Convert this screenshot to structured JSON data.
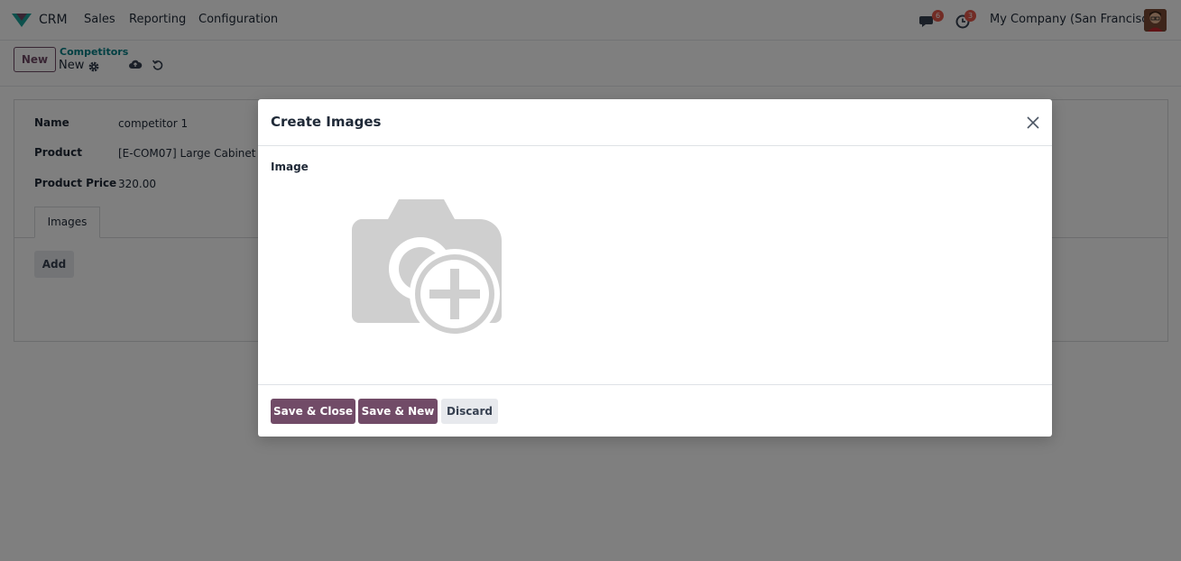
{
  "navbar": {
    "app_name": "CRM",
    "menu": [
      "Sales",
      "Reporting",
      "Configuration"
    ],
    "messages_count": "6",
    "activities_count": "3",
    "company": "My Company (San Francisco)",
    "icons": {
      "app": "crm-logo-icon",
      "messages": "chat-bubbles-icon",
      "activities": "clock-icon"
    }
  },
  "control_panel": {
    "new_label": "New",
    "breadcrumb_parent": "Competitors",
    "breadcrumb_current": "New"
  },
  "form": {
    "fields": [
      {
        "label": "Name",
        "value": "competitor 1"
      },
      {
        "label": "Product",
        "value": "[E-COM07] Large Cabinet"
      },
      {
        "label": "Product Price",
        "value": "320.00"
      }
    ],
    "tab_label": "Images",
    "add_label": "Add"
  },
  "dialog": {
    "title": "Create Images",
    "image_label": "Image",
    "save_close_label": "Save & Close",
    "save_new_label": "Save & New",
    "discard_label": "Discard"
  },
  "colors": {
    "primary": "#714b67",
    "link": "#017e84",
    "badge": "#e4594b"
  }
}
